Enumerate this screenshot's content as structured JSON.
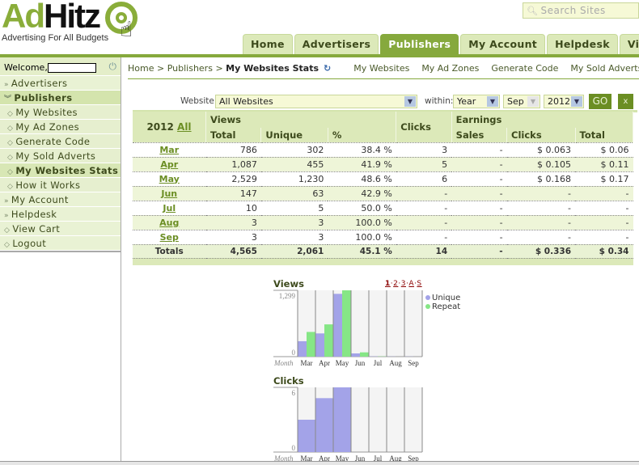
{
  "header": {
    "logo_ad": "Ad",
    "logo_hitz": "Hitz",
    "tagline": "Advertising For All Budgets",
    "search_placeholder": "Search Sites",
    "tabs": [
      {
        "label": "Home",
        "active": false
      },
      {
        "label": "Advertisers",
        "active": false
      },
      {
        "label": "Publishers",
        "active": true
      },
      {
        "label": "My Account",
        "active": false
      },
      {
        "label": "Helpdesk",
        "active": false
      },
      {
        "label": "View Cart",
        "active": false
      }
    ]
  },
  "sidebar": {
    "welcome": "Welcome,",
    "items": [
      {
        "label": "Advertisers",
        "icon": "double-chevron-right"
      },
      {
        "label": "Publishers",
        "icon": "double-chevron-down"
      },
      {
        "label": "My Websites",
        "icon": "diamond"
      },
      {
        "label": "My Ad Zones",
        "icon": "diamond"
      },
      {
        "label": "Generate Code",
        "icon": "diamond"
      },
      {
        "label": "My Sold Adverts",
        "icon": "diamond"
      },
      {
        "label": "My Websites Stats",
        "icon": "diamond"
      },
      {
        "label": "How it Works",
        "icon": "diamond"
      },
      {
        "label": "My Account",
        "icon": "double-chevron-right"
      },
      {
        "label": "Helpdesk",
        "icon": "double-chevron-right"
      },
      {
        "label": "View Cart",
        "icon": "diamond"
      },
      {
        "label": "Logout",
        "icon": "diamond"
      }
    ]
  },
  "breadcrumb": {
    "home": "Home",
    "sep": ">",
    "publishers": "Publishers",
    "current": "My Websites Stats",
    "sublinks": [
      "My Websites",
      "My Ad Zones",
      "Generate Code",
      "My Sold Adverts"
    ]
  },
  "filter": {
    "website_label": "Website:",
    "website_value": "All Websites",
    "within_label": "within:",
    "period_value": "Year",
    "month_value": "Sep",
    "year_value": "2012",
    "go_label": "GO",
    "clear_label": "x"
  },
  "stats": {
    "year": "2012",
    "all_link": "All",
    "headers": {
      "views": "Views",
      "clicks": "Clicks",
      "earnings": "Earnings",
      "total": "Total",
      "unique": "Unique",
      "pct": "%",
      "sales": "Sales",
      "e_clicks": "Clicks",
      "e_total": "Total"
    },
    "rows": [
      {
        "month": "Mar",
        "total": "786",
        "unique": "302",
        "pct": "38.4 %",
        "clicks": "3",
        "sales": "-",
        "e_clicks": "$ 0.063",
        "e_total": "$ 0.06"
      },
      {
        "month": "Apr",
        "total": "1,087",
        "unique": "455",
        "pct": "41.9 %",
        "clicks": "5",
        "sales": "-",
        "e_clicks": "$ 0.105",
        "e_total": "$ 0.11"
      },
      {
        "month": "May",
        "total": "2,529",
        "unique": "1,230",
        "pct": "48.6 %",
        "clicks": "6",
        "sales": "-",
        "e_clicks": "$ 0.168",
        "e_total": "$ 0.17"
      },
      {
        "month": "Jun",
        "total": "147",
        "unique": "63",
        "pct": "42.9 %",
        "clicks": "-",
        "sales": "-",
        "e_clicks": "-",
        "e_total": "-"
      },
      {
        "month": "Jul",
        "total": "10",
        "unique": "5",
        "pct": "50.0 %",
        "clicks": "-",
        "sales": "-",
        "e_clicks": "-",
        "e_total": "-"
      },
      {
        "month": "Aug",
        "total": "3",
        "unique": "3",
        "pct": "100.0 %",
        "clicks": "-",
        "sales": "-",
        "e_clicks": "-",
        "e_total": "-"
      },
      {
        "month": "Sep",
        "total": "3",
        "unique": "3",
        "pct": "100.0 %",
        "clicks": "-",
        "sales": "-",
        "e_clicks": "-",
        "e_total": "-"
      }
    ],
    "totals": {
      "label": "Totals",
      "total": "4,565",
      "unique": "2,061",
      "pct": "45.1 %",
      "clicks": "14",
      "sales": "-",
      "e_clicks": "$ 0.336",
      "e_total": "$ 0.34"
    }
  },
  "chart_data": [
    {
      "type": "bar",
      "title": "Views",
      "tools": [
        "1",
        "2",
        "3",
        "A",
        "S"
      ],
      "categories": [
        "Mar",
        "Apr",
        "May",
        "Jun",
        "Jul",
        "Aug",
        "Sep"
      ],
      "xlabel": "Month",
      "ylim": [
        0,
        1299
      ],
      "yticks": [
        "0",
        "1,299"
      ],
      "series": [
        {
          "name": "Unique",
          "color": "#a3a3e8",
          "values": [
            302,
            455,
            1230,
            63,
            5,
            3,
            3
          ]
        },
        {
          "name": "Repeat",
          "color": "#86e686",
          "values": [
            484,
            632,
            1299,
            84,
            5,
            0,
            0
          ]
        }
      ],
      "legend": "right"
    },
    {
      "type": "bar",
      "title": "Clicks",
      "categories": [
        "Mar",
        "Apr",
        "May",
        "Jun",
        "Jul",
        "Aug",
        "Sep"
      ],
      "xlabel": "Month",
      "ylim": [
        0,
        6
      ],
      "yticks": [
        "0",
        "6"
      ],
      "series": [
        {
          "name": "Clicks",
          "color": "#a3a3e8",
          "values": [
            3,
            5,
            6,
            0,
            0,
            0,
            0
          ]
        }
      ]
    }
  ]
}
